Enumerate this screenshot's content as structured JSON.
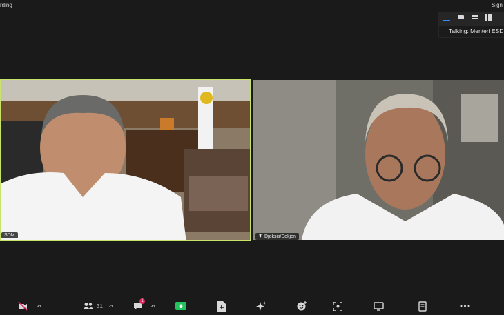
{
  "header": {
    "recording_label": "rding",
    "sign_label": "Sign"
  },
  "view_panel": {
    "talking_text": "Talking: Menteri ESD"
  },
  "participants": [
    {
      "name_tag": "SDM"
    },
    {
      "name_tag": "Djoksis/Sekjen"
    }
  ],
  "toolbar": {
    "participants_count": "31",
    "chat_badge": "1"
  },
  "colors": {
    "active_speaker_border": "#c9e26a",
    "accent": "#2d8cff",
    "share_green": "#22c35d",
    "badge_red": "#e0245e"
  }
}
